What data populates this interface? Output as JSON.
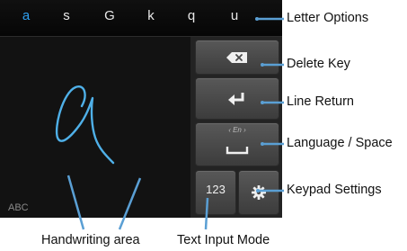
{
  "letter_options": [
    "a",
    "s",
    "G",
    "k",
    "q",
    "u"
  ],
  "active_letter_index": 0,
  "handwriting": {
    "mode_label": "ABC"
  },
  "keys": {
    "text_input_mode_label": "123",
    "language_label": "En"
  },
  "callouts": {
    "letter_options": "Letter Options",
    "delete_key": "Delete Key",
    "line_return": "Line Return",
    "language_space": "Language / Space",
    "keypad_settings": "Keypad Settings",
    "handwriting_area": "Handwriting area",
    "text_input_mode": "Text Input Mode"
  },
  "colors": {
    "accent": "#2fa0f0",
    "stroke": "#4fb0e8",
    "leader": "#5a9fd4"
  },
  "icons": {
    "delete": "backspace-icon",
    "return": "return-icon",
    "space": "space-icon",
    "settings": "gear-icon"
  }
}
